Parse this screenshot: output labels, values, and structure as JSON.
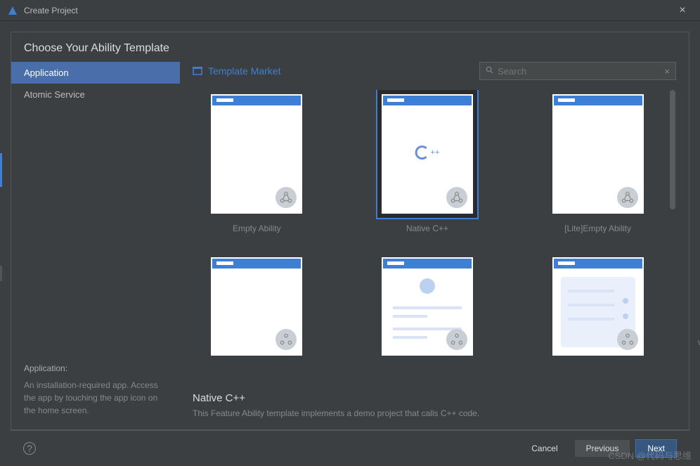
{
  "titlebar": {
    "title": "Create Project"
  },
  "heading": "Choose Your Ability Template",
  "sidebar": {
    "items": [
      {
        "label": "Application",
        "selected": true
      },
      {
        "label": "Atomic Service",
        "selected": false
      }
    ],
    "footer_title": "Application:",
    "footer_desc": "An installation-required app. Access the app by touching the app icon on the home screen."
  },
  "main": {
    "market_label": "Template Market",
    "search_placeholder": "Search",
    "templates": [
      {
        "label": "Empty Ability",
        "kind": "empty",
        "selected": false
      },
      {
        "label": "Native C++",
        "kind": "cpp",
        "selected": true
      },
      {
        "label": "[Lite]Empty Ability",
        "kind": "empty",
        "selected": false
      },
      {
        "label": "",
        "kind": "empty2",
        "selected": false
      },
      {
        "label": "",
        "kind": "profile",
        "selected": false
      },
      {
        "label": "",
        "kind": "card",
        "selected": false
      }
    ],
    "selected_title": "Native C++",
    "selected_desc": "This Feature Ability template implements a demo project that calls C++ code."
  },
  "buttons": {
    "cancel": "Cancel",
    "previous": "Previous",
    "next": "Next"
  },
  "watermark": "CSDN @代码与思维"
}
